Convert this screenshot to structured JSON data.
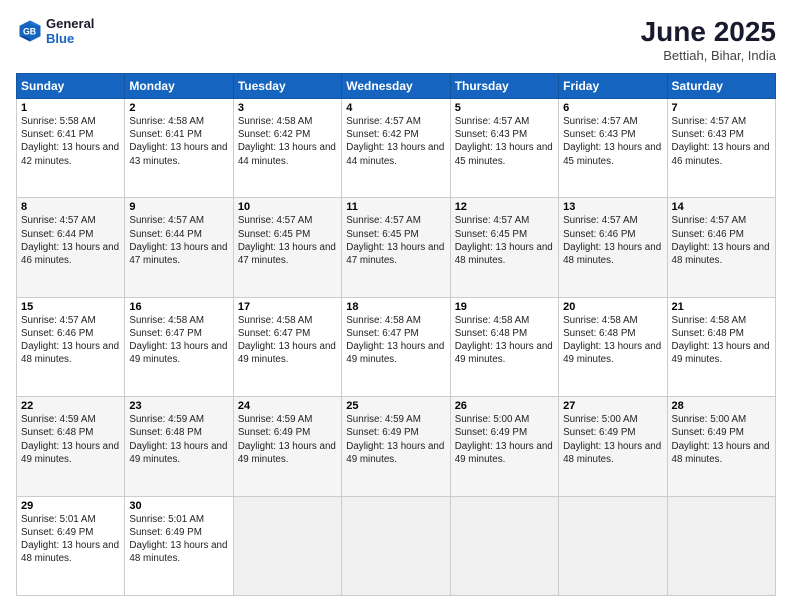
{
  "header": {
    "logo_line1": "General",
    "logo_line2": "Blue",
    "month_title": "June 2025",
    "location": "Bettiah, Bihar, India"
  },
  "weekdays": [
    "Sunday",
    "Monday",
    "Tuesday",
    "Wednesday",
    "Thursday",
    "Friday",
    "Saturday"
  ],
  "weeks": [
    [
      {
        "day": "1",
        "sunrise": "5:58 AM",
        "sunset": "6:41 PM",
        "daylight": "13 hours and 42 minutes."
      },
      {
        "day": "2",
        "sunrise": "4:58 AM",
        "sunset": "6:41 PM",
        "daylight": "13 hours and 43 minutes."
      },
      {
        "day": "3",
        "sunrise": "4:58 AM",
        "sunset": "6:42 PM",
        "daylight": "13 hours and 44 minutes."
      },
      {
        "day": "4",
        "sunrise": "4:57 AM",
        "sunset": "6:42 PM",
        "daylight": "13 hours and 44 minutes."
      },
      {
        "day": "5",
        "sunrise": "4:57 AM",
        "sunset": "6:43 PM",
        "daylight": "13 hours and 45 minutes."
      },
      {
        "day": "6",
        "sunrise": "4:57 AM",
        "sunset": "6:43 PM",
        "daylight": "13 hours and 45 minutes."
      },
      {
        "day": "7",
        "sunrise": "4:57 AM",
        "sunset": "6:43 PM",
        "daylight": "13 hours and 46 minutes."
      }
    ],
    [
      {
        "day": "8",
        "sunrise": "4:57 AM",
        "sunset": "6:44 PM",
        "daylight": "13 hours and 46 minutes."
      },
      {
        "day": "9",
        "sunrise": "4:57 AM",
        "sunset": "6:44 PM",
        "daylight": "13 hours and 47 minutes."
      },
      {
        "day": "10",
        "sunrise": "4:57 AM",
        "sunset": "6:45 PM",
        "daylight": "13 hours and 47 minutes."
      },
      {
        "day": "11",
        "sunrise": "4:57 AM",
        "sunset": "6:45 PM",
        "daylight": "13 hours and 47 minutes."
      },
      {
        "day": "12",
        "sunrise": "4:57 AM",
        "sunset": "6:45 PM",
        "daylight": "13 hours and 48 minutes."
      },
      {
        "day": "13",
        "sunrise": "4:57 AM",
        "sunset": "6:46 PM",
        "daylight": "13 hours and 48 minutes."
      },
      {
        "day": "14",
        "sunrise": "4:57 AM",
        "sunset": "6:46 PM",
        "daylight": "13 hours and 48 minutes."
      }
    ],
    [
      {
        "day": "15",
        "sunrise": "4:57 AM",
        "sunset": "6:46 PM",
        "daylight": "13 hours and 48 minutes."
      },
      {
        "day": "16",
        "sunrise": "4:58 AM",
        "sunset": "6:47 PM",
        "daylight": "13 hours and 49 minutes."
      },
      {
        "day": "17",
        "sunrise": "4:58 AM",
        "sunset": "6:47 PM",
        "daylight": "13 hours and 49 minutes."
      },
      {
        "day": "18",
        "sunrise": "4:58 AM",
        "sunset": "6:47 PM",
        "daylight": "13 hours and 49 minutes."
      },
      {
        "day": "19",
        "sunrise": "4:58 AM",
        "sunset": "6:48 PM",
        "daylight": "13 hours and 49 minutes."
      },
      {
        "day": "20",
        "sunrise": "4:58 AM",
        "sunset": "6:48 PM",
        "daylight": "13 hours and 49 minutes."
      },
      {
        "day": "21",
        "sunrise": "4:58 AM",
        "sunset": "6:48 PM",
        "daylight": "13 hours and 49 minutes."
      }
    ],
    [
      {
        "day": "22",
        "sunrise": "4:59 AM",
        "sunset": "6:48 PM",
        "daylight": "13 hours and 49 minutes."
      },
      {
        "day": "23",
        "sunrise": "4:59 AM",
        "sunset": "6:48 PM",
        "daylight": "13 hours and 49 minutes."
      },
      {
        "day": "24",
        "sunrise": "4:59 AM",
        "sunset": "6:49 PM",
        "daylight": "13 hours and 49 minutes."
      },
      {
        "day": "25",
        "sunrise": "4:59 AM",
        "sunset": "6:49 PM",
        "daylight": "13 hours and 49 minutes."
      },
      {
        "day": "26",
        "sunrise": "5:00 AM",
        "sunset": "6:49 PM",
        "daylight": "13 hours and 49 minutes."
      },
      {
        "day": "27",
        "sunrise": "5:00 AM",
        "sunset": "6:49 PM",
        "daylight": "13 hours and 48 minutes."
      },
      {
        "day": "28",
        "sunrise": "5:00 AM",
        "sunset": "6:49 PM",
        "daylight": "13 hours and 48 minutes."
      }
    ],
    [
      {
        "day": "29",
        "sunrise": "5:01 AM",
        "sunset": "6:49 PM",
        "daylight": "13 hours and 48 minutes."
      },
      {
        "day": "30",
        "sunrise": "5:01 AM",
        "sunset": "6:49 PM",
        "daylight": "13 hours and 48 minutes."
      },
      null,
      null,
      null,
      null,
      null
    ]
  ]
}
